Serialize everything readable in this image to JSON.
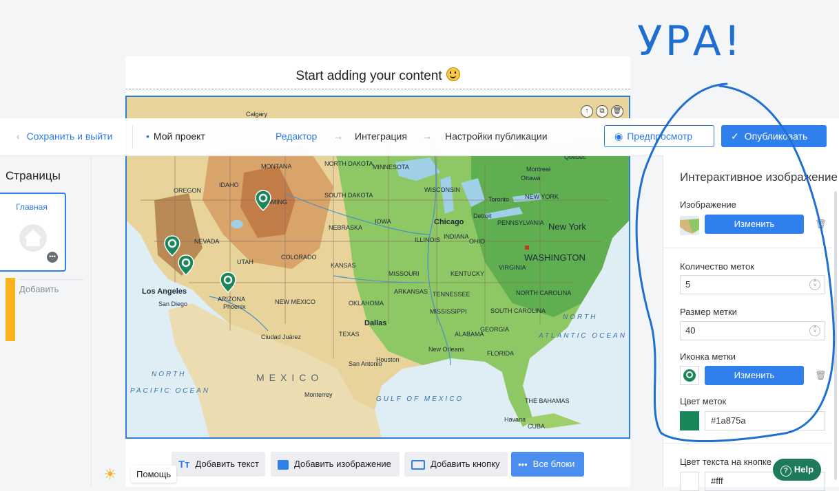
{
  "canvas": {
    "title": "Start adding your content"
  },
  "map": {
    "labels": {
      "calgary": "Calgary",
      "montana": "MONTANA",
      "north_dakota": "NORTH DAKOTA",
      "minnesota": "MINNESOTA",
      "montreal": "Montreal",
      "ottawa": "Ottawa",
      "quebec": "Quebec",
      "oregon": "OREGON",
      "idaho": "IDAHO",
      "wyoming": "WYOMING",
      "south_dakota": "SOUTH DAKOTA",
      "wisconsin": "WISCONSIN",
      "toronto": "Toronto",
      "new_york_state": "NEW YORK",
      "nebraska": "NEBRASKA",
      "iowa": "IOWA",
      "chicago": "Chicago",
      "detroit": "Detroit",
      "pennsylvania": "PENNSYLVANIA",
      "new_york": "New York",
      "nevada": "NEVADA",
      "utah": "UTAH",
      "colorado": "COLORADO",
      "kansas": "KANSAS",
      "illinois": "ILLINOIS",
      "indiana": "INDIANA",
      "ohio": "OHIO",
      "washington": "WASHINGTON",
      "virginia": "VIRGINIA",
      "missouri": "MISSOURI",
      "kentucky": "KENTUCKY",
      "los_angeles": "Los Angeles",
      "san_diego": "San Diego",
      "arizona": "ARIZONA",
      "phoenix": "Phoenix",
      "new_mexico": "NEW MEXICO",
      "oklahoma": "OKLAHOMA",
      "arkansas": "ARKANSAS",
      "tennessee": "TENNESSEE",
      "north_carolina": "NORTH CAROLINA",
      "dallas": "Dallas",
      "texas": "TEXAS",
      "mississippi": "MISSISSIPPI",
      "alabama": "ALABAMA",
      "georgia": "GEORGIA",
      "south_carolina": "SOUTH CAROLINA",
      "ciudad_juarez": "Ciudad Juárez",
      "san_antonio": "San Antonio",
      "houston": "Houston",
      "new_orleans": "New Orleans",
      "florida": "FLORIDA",
      "north_atlantic_1": "NORTH",
      "north_atlantic_2": "ATLANTIC OCEAN",
      "north_pacific_1": "NORTH",
      "north_pacific_2": "PACIFIC OCEAN",
      "mexico": "MEXICO",
      "monterrey": "Monterrey",
      "gulf": "GULF OF MEXICO",
      "havana": "Havana",
      "cuba": "CUBA",
      "bahamas": "THE BAHAMAS"
    },
    "tools": {
      "up": "↑",
      "copy": "⧉",
      "delete": "🗑"
    }
  },
  "topbar": {
    "save_exit": "Сохранить и выйти",
    "project": "Мой проект",
    "steps": [
      "Редактор",
      "Интеграция",
      "Настройки публикации"
    ],
    "arrow": "→",
    "preview": "Предпросмотр",
    "publish": "Опубликовать"
  },
  "left": {
    "title": "Страницы",
    "page_name": "Главная",
    "add": "Добавить"
  },
  "toolbar": {
    "add_text": "Добавить текст",
    "add_image": "Добавить изображение",
    "add_button": "Добавить кнопку",
    "all_blocks": "Все блоки"
  },
  "help_hint": "Помощь",
  "panel": {
    "title": "Интерактивное изображение",
    "image_label": "Изображение",
    "change": "Изменить",
    "marker_count_label": "Количество меток",
    "marker_count": "5",
    "marker_size_label": "Размер метки",
    "marker_size": "40",
    "marker_icon_label": "Иконка метки",
    "marker_color_label": "Цвет меток",
    "marker_color": "#1a875a",
    "button_text_color_label": "Цвет текста на кнопке",
    "button_text_color": "#fff"
  },
  "help_button": "Help",
  "handwriting": "УРА!",
  "colors": {
    "accent": "#2f80ed",
    "marker": "#1a875a",
    "scribble": "#1f6fd1",
    "warning": "#fbb21f"
  }
}
